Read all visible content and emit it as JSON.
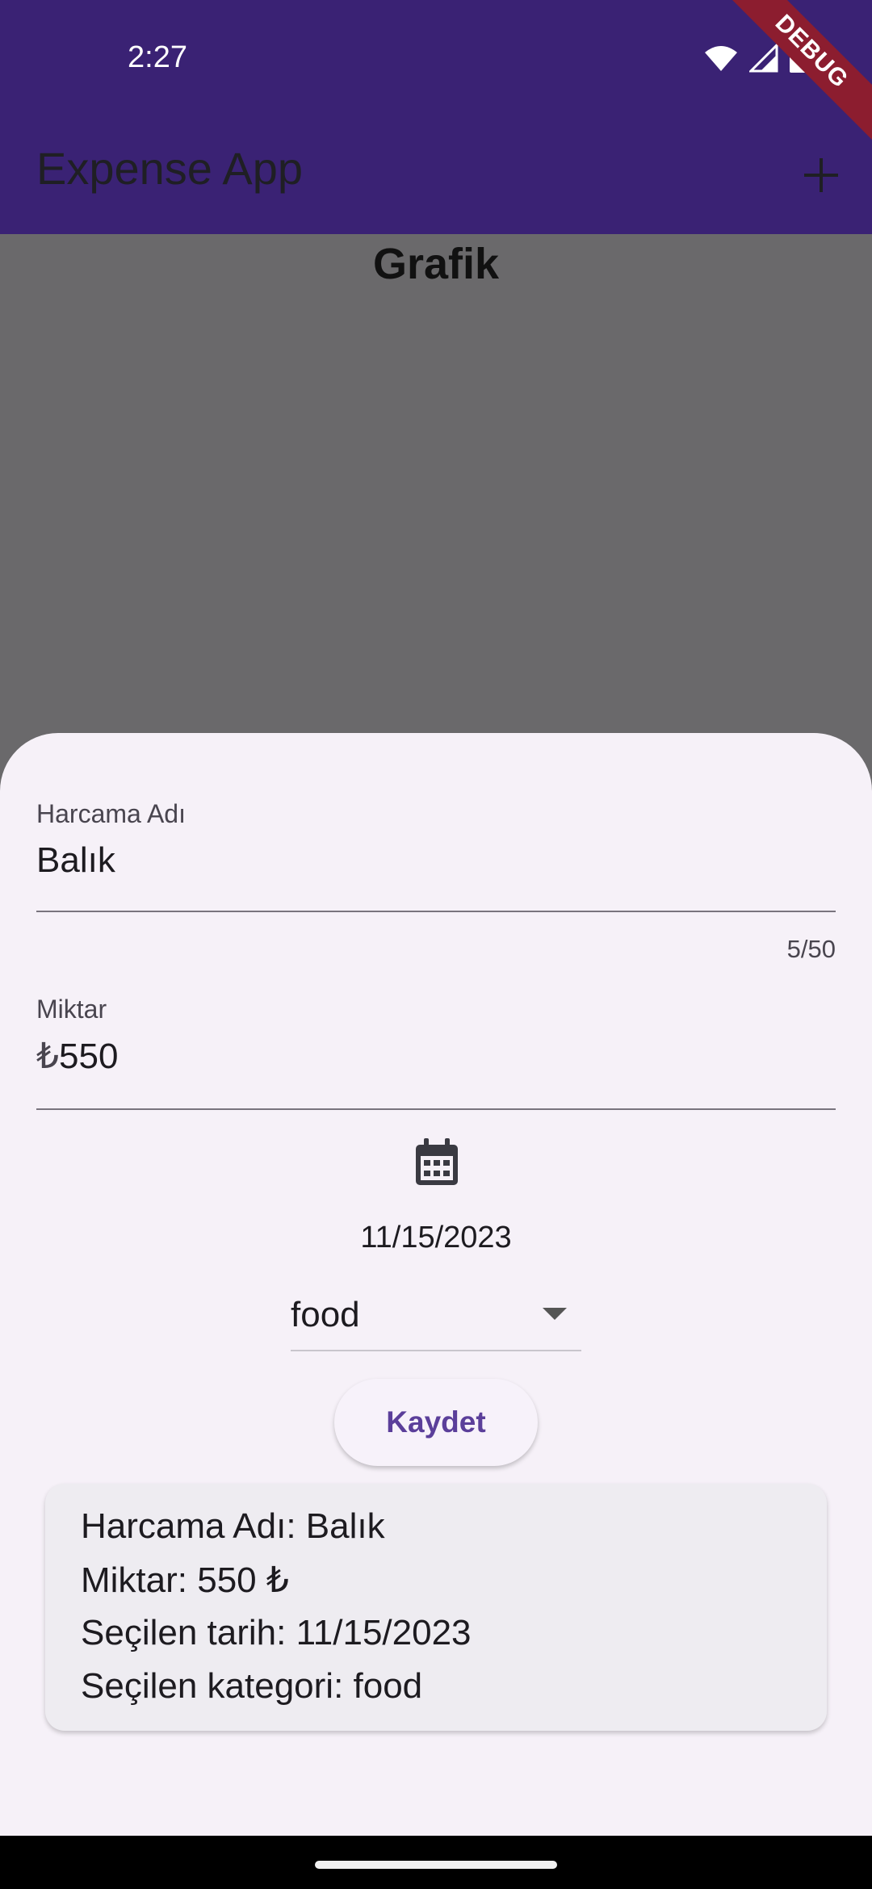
{
  "status_bar": {
    "time": "2:27"
  },
  "app_bar": {
    "title": "Expense App",
    "debug_label": "DEBUG"
  },
  "background": {
    "chart_title": "Grafik"
  },
  "form": {
    "name_field": {
      "label": "Harcama Adı",
      "value": "Balık",
      "counter": "5/50"
    },
    "amount_field": {
      "label": "Miktar",
      "prefix": "₺",
      "value": "550"
    },
    "date": "11/15/2023",
    "category": {
      "selected": "food"
    },
    "save_label": "Kaydet"
  },
  "summary": {
    "name_line": "Harcama Adı: Balık",
    "amount_line": "Miktar: 550 ₺",
    "date_line": "Seçilen tarih: 11/15/2023",
    "category_line": "Seçilen kategori: food"
  },
  "colors": {
    "app_bar": "#3a2274",
    "accent": "#5b3f9a",
    "scrim": "#6a696b",
    "sheet": "#f6f1f8"
  }
}
